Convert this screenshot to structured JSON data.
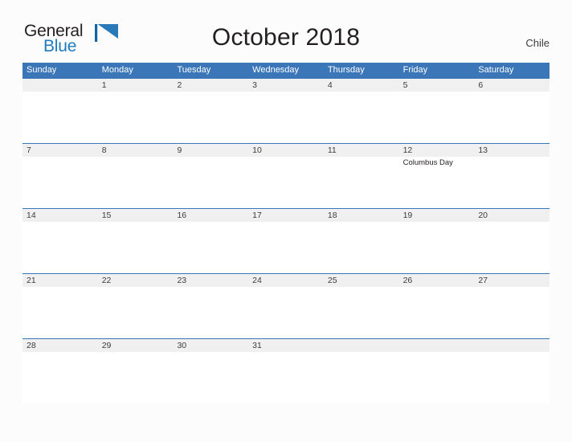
{
  "logo": {
    "word_one": "General",
    "word_two": "Blue",
    "flag_icon": "blue-flag-icon"
  },
  "header": {
    "title": "October 2018",
    "region": "Chile"
  },
  "colors": {
    "header_blue": "#3a76b8",
    "rule_blue": "#3a76b8",
    "logo_blue": "#1f7bc1",
    "date_band_gray": "#f0f0f0",
    "page_background": "#fcfcfc",
    "text_dark": "#3c3c3c"
  },
  "calendar": {
    "weekdays": [
      "Sunday",
      "Monday",
      "Tuesday",
      "Wednesday",
      "Thursday",
      "Friday",
      "Saturday"
    ],
    "weeks": [
      {
        "days": [
          {
            "date": "",
            "event": ""
          },
          {
            "date": "1",
            "event": ""
          },
          {
            "date": "2",
            "event": ""
          },
          {
            "date": "3",
            "event": ""
          },
          {
            "date": "4",
            "event": ""
          },
          {
            "date": "5",
            "event": ""
          },
          {
            "date": "6",
            "event": ""
          }
        ]
      },
      {
        "days": [
          {
            "date": "7",
            "event": ""
          },
          {
            "date": "8",
            "event": ""
          },
          {
            "date": "9",
            "event": ""
          },
          {
            "date": "10",
            "event": ""
          },
          {
            "date": "11",
            "event": ""
          },
          {
            "date": "12",
            "event": "Columbus Day"
          },
          {
            "date": "13",
            "event": ""
          }
        ]
      },
      {
        "days": [
          {
            "date": "14",
            "event": ""
          },
          {
            "date": "15",
            "event": ""
          },
          {
            "date": "16",
            "event": ""
          },
          {
            "date": "17",
            "event": ""
          },
          {
            "date": "18",
            "event": ""
          },
          {
            "date": "19",
            "event": ""
          },
          {
            "date": "20",
            "event": ""
          }
        ]
      },
      {
        "days": [
          {
            "date": "21",
            "event": ""
          },
          {
            "date": "22",
            "event": ""
          },
          {
            "date": "23",
            "event": ""
          },
          {
            "date": "24",
            "event": ""
          },
          {
            "date": "25",
            "event": ""
          },
          {
            "date": "26",
            "event": ""
          },
          {
            "date": "27",
            "event": ""
          }
        ]
      },
      {
        "days": [
          {
            "date": "28",
            "event": ""
          },
          {
            "date": "29",
            "event": ""
          },
          {
            "date": "30",
            "event": ""
          },
          {
            "date": "31",
            "event": ""
          },
          {
            "date": "",
            "event": ""
          },
          {
            "date": "",
            "event": ""
          },
          {
            "date": "",
            "event": ""
          }
        ]
      }
    ]
  }
}
